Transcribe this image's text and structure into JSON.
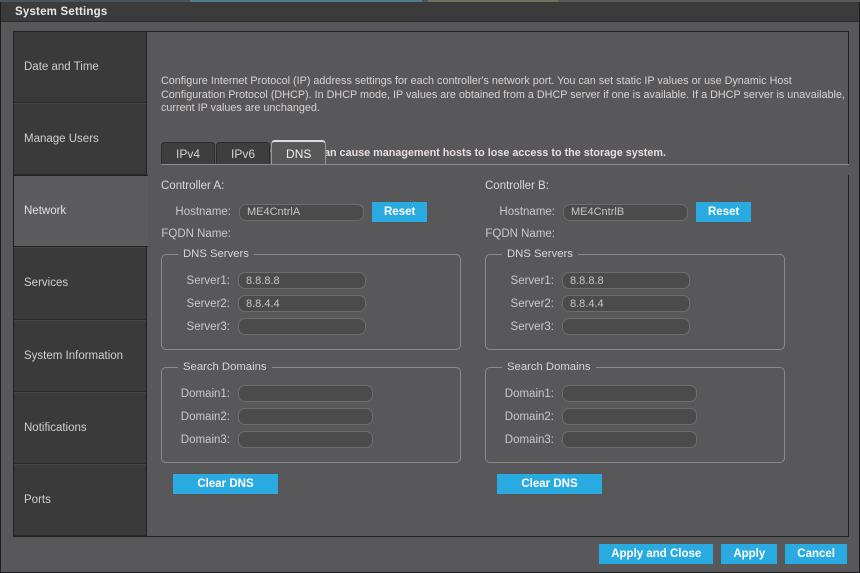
{
  "window": {
    "title": "System Settings"
  },
  "sidebar": {
    "items": [
      {
        "label": "Date and Time",
        "selected": false
      },
      {
        "label": "Manage Users",
        "selected": false
      },
      {
        "label": "Network",
        "selected": true
      },
      {
        "label": "Services",
        "selected": false
      },
      {
        "label": "System Information",
        "selected": false
      },
      {
        "label": "Notifications",
        "selected": false
      },
      {
        "label": "Ports",
        "selected": false
      }
    ]
  },
  "content": {
    "intro": "Configure Internet Protocol (IP) address settings for each controller's network port. You can set static IP values or use Dynamic Host Configuration Protocol (DHCP). In DHCP mode, IP values are obtained from a DHCP server if one is available. If a DHCP server is unavailable, current IP values are unchanged.",
    "caution": "Caution: Changing IP settings can cause management hosts to lose access to the storage system.",
    "tabs": [
      {
        "label": "IPv4",
        "active": false
      },
      {
        "label": "IPv6",
        "active": false
      },
      {
        "label": "DNS",
        "active": true
      }
    ]
  },
  "controller_a": {
    "title": "Controller A:",
    "hostname_label": "Hostname:",
    "hostname_value": "ME4CntrlA",
    "hostname_placeholder": "",
    "reset_label": "Reset",
    "fqdn_label": "FQDN Name:",
    "dns_servers": {
      "legend": "DNS Servers",
      "rows": [
        {
          "label": "Server1:",
          "value": "8.8.8.8"
        },
        {
          "label": "Server2:",
          "value": "8.8.4.4"
        },
        {
          "label": "Server3:",
          "value": ""
        }
      ]
    },
    "search_domains": {
      "legend": "Search Domains",
      "rows": [
        {
          "label": "Domain1:",
          "value": ""
        },
        {
          "label": "Domain2:",
          "value": ""
        },
        {
          "label": "Domain3:",
          "value": ""
        }
      ]
    },
    "clear_label": "Clear DNS"
  },
  "controller_b": {
    "title": "Controller B:",
    "hostname_label": "Hostname:",
    "hostname_value": "ME4CntrlB",
    "hostname_placeholder": "",
    "reset_label": "Reset",
    "fqdn_label": "FQDN Name:",
    "dns_servers": {
      "legend": "DNS Servers",
      "rows": [
        {
          "label": "Server1:",
          "value": "8.8.8.8"
        },
        {
          "label": "Server2:",
          "value": "8.8.4.4"
        },
        {
          "label": "Server3:",
          "value": ""
        }
      ]
    },
    "search_domains": {
      "legend": "Search Domains",
      "rows": [
        {
          "label": "Domain1:",
          "value": ""
        },
        {
          "label": "Domain2:",
          "value": ""
        },
        {
          "label": "Domain3:",
          "value": ""
        }
      ]
    },
    "clear_label": "Clear DNS"
  },
  "footer": {
    "apply_and_close_label": "Apply and Close",
    "apply_label": "Apply",
    "cancel_label": "Cancel"
  },
  "colors": {
    "accent": "#29ABE2",
    "dialog_bg": "#58585a",
    "sidebar_bg": "#3a3a3a",
    "sidebar_selected_bg": "#5c5c5e",
    "titlebar_bg": "#3b3b3b",
    "field_bg": "#4b4b4b"
  }
}
